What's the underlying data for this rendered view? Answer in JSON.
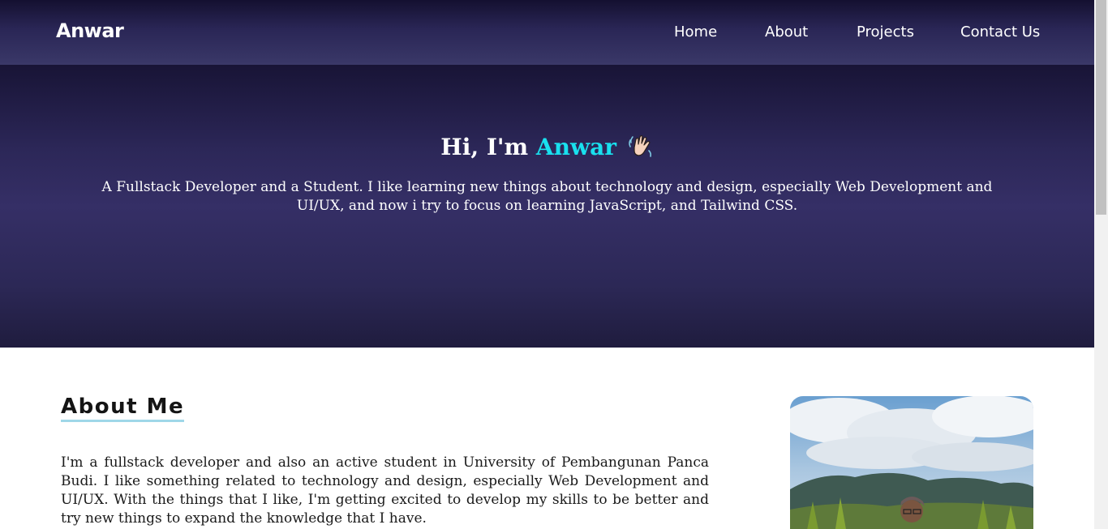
{
  "navbar": {
    "brand": "Anwar",
    "links": [
      {
        "label": "Home"
      },
      {
        "label": "About"
      },
      {
        "label": "Projects"
      },
      {
        "label": "Contact Us"
      }
    ]
  },
  "hero": {
    "greeting": "Hi, I'm ",
    "name": "Anwar",
    "emoji": "waving-hand-icon",
    "description": "A Fullstack Developer and a Student. I like learning new things about technology and design, especially Web Development and UI/UX, and now i try to focus on learning JavaScript, and Tailwind CSS."
  },
  "about": {
    "title": "About Me",
    "text": "I'm a fullstack developer and also an active student in University of Pembangunan Panca Budi. I like something related to technology and design, especially Web Development and UI/UX. With the things that I like, I'm getting excited to develop my skills to be better and try new things to expand the knowledge that I have."
  },
  "colors": {
    "accent": "#19e0ee",
    "navbar_bg": "#2a2656",
    "hero_bg": "#352f66",
    "underline": "#9fd7e8"
  }
}
